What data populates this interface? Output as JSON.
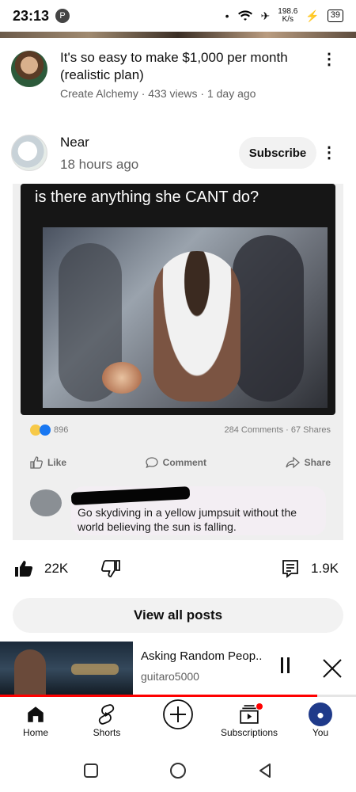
{
  "status_bar": {
    "time": "23:13",
    "notification_icon": "P",
    "net_speed": "198.6",
    "net_unit": "K/s",
    "battery": "39"
  },
  "video_item": {
    "title": "It's so easy to make $1,000 per month (realistic plan)",
    "meta": "Create Alchemy · 433 views · 1 day ago"
  },
  "post": {
    "author": "Near",
    "time": "18 hours ago",
    "subscribe_label": "Subscribe",
    "image": {
      "caption": "is there anything she CANT do?",
      "reactions_count": "896",
      "stats_right": "284 Comments · 67 Shares",
      "like_label": "Like",
      "comment_label": "Comment",
      "share_label": "Share",
      "comment_text": "Go skydiving in a yellow jumpsuit without the world believing the sun is falling."
    },
    "like_count": "22K",
    "comment_count": "1.9K",
    "view_all_label": "View all posts"
  },
  "mini_player": {
    "title": "Asking Random Peop..",
    "channel": "guitaro5000",
    "progress": 0.89
  },
  "bottom_nav": {
    "items": [
      {
        "label": "Home",
        "icon": "home-icon"
      },
      {
        "label": "Shorts",
        "icon": "shorts-icon"
      },
      {
        "label": "",
        "icon": "create-icon"
      },
      {
        "label": "Subscriptions",
        "icon": "subscriptions-icon"
      },
      {
        "label": "You",
        "icon": "avatar"
      }
    ]
  },
  "colors": {
    "accent": "#ff0000",
    "text": "#0f0f0f",
    "secondary": "#606060",
    "chip_bg": "#f2f2f2"
  }
}
